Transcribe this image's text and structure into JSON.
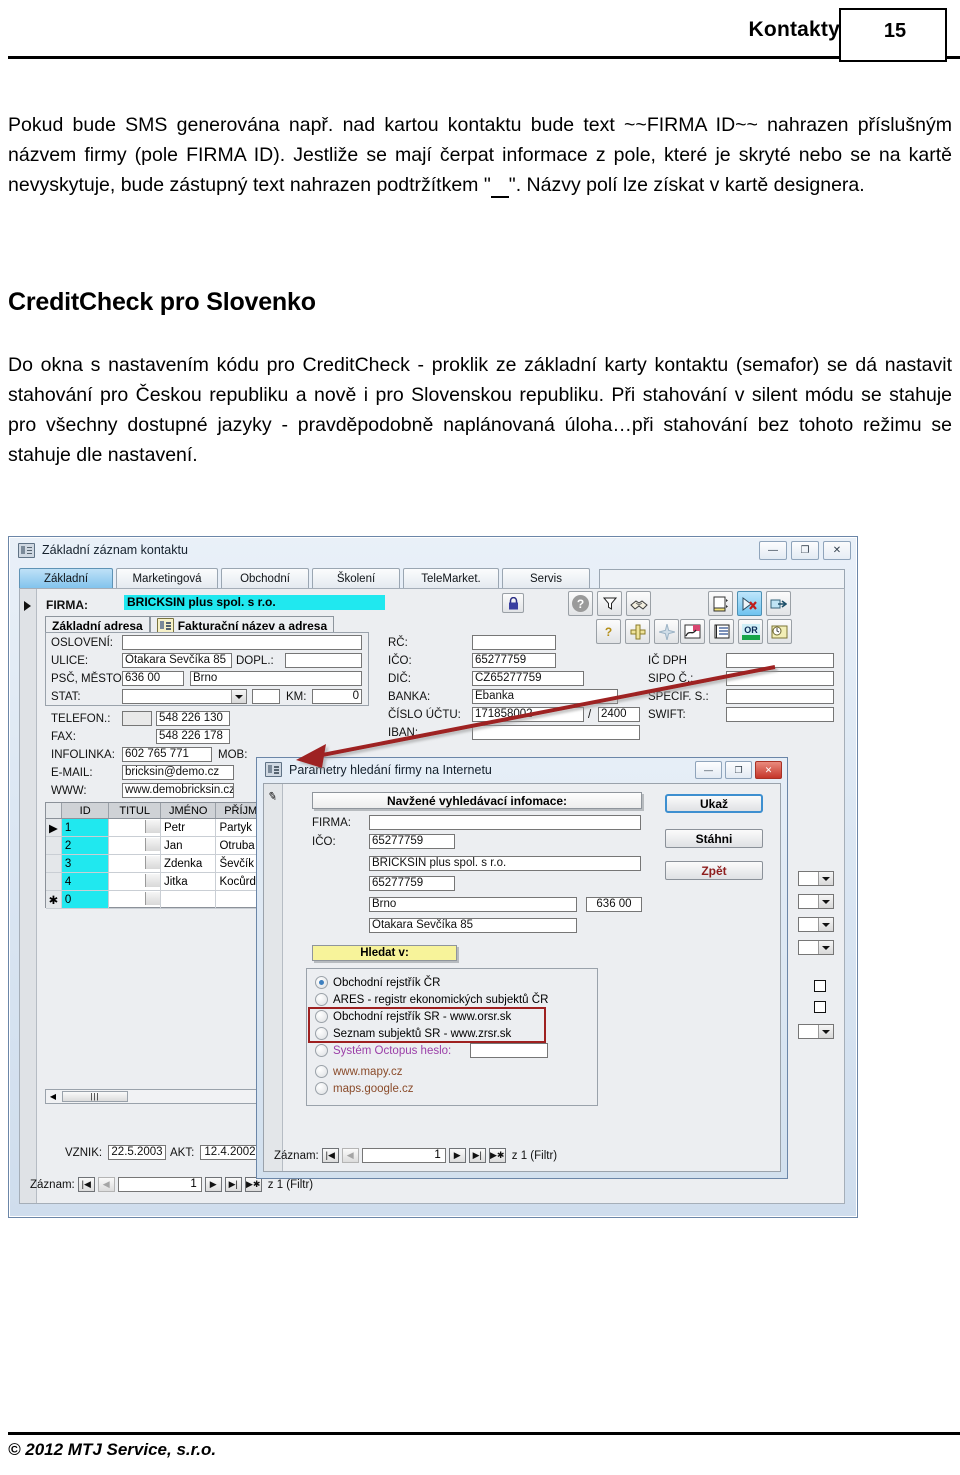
{
  "page": {
    "header_title": "Kontakty",
    "page_number": "15",
    "footer": "© 2012 MTJ Service, s.r.o."
  },
  "content": {
    "paragraph1": "Pokud bude SMS generována např. nad kartou kontaktu bude text ~~FIRMA ID~~ nahrazen příslušným názvem firmy (pole FIRMA ID). Jestliže se mají čerpat informace z pole, které je skryté nebo se na kartě nevyskytuje, bude zástupný text nahrazen podtržítkem \"",
    "paragraph1_end": "\". Názvy polí lze získat v kartě designera.",
    "section_title": "CreditCheck pro Slovenko",
    "paragraph2": "Do okna s nastavením kódu pro CreditCheck - proklik ze základní karty kontaktu (semafor) se dá nastavit stahování pro Českou republiku a nově i pro Slovenskou republiku. Při stahování v silent módu se stahuje pro všechny dostupné jazyky - pravděpodobně naplánovaná úloha…při stahování bez tohoto režimu se stahuje dle nastavení."
  },
  "main_window": {
    "title": "Základní záznam kontaktu",
    "window_buttons": {
      "minimize": "—",
      "maximize": "❐",
      "close": "✕"
    },
    "tabs": [
      {
        "label": "Základní",
        "selected": true
      },
      {
        "label": "Marketingová",
        "selected": false
      },
      {
        "label": "Obchodní",
        "selected": false
      },
      {
        "label": "Školení",
        "selected": false
      },
      {
        "label": "TeleMarket.",
        "selected": false
      },
      {
        "label": "Servis",
        "selected": false
      }
    ],
    "firma_label": "FIRMA:",
    "firma_value": "BRICKSIN plus spol.  s r.o.",
    "lock_icon": "lock-icon",
    "subtabs": [
      {
        "label": "Základní adresa",
        "selected": true
      },
      {
        "label": "Fakturační název a adresa",
        "selected": false
      }
    ],
    "address_fields": [
      {
        "label": "OSLOVENÍ:",
        "value": ""
      },
      {
        "label": "ULICE:",
        "value": "Otakara Ševčíka 85"
      },
      {
        "label": "DOPL.:",
        "value": ""
      },
      {
        "label": "PSČ, MĚSTO:",
        "value": "636 00"
      },
      {
        "label": "",
        "value": "Brno"
      },
      {
        "label": "STAT:",
        "value": ""
      },
      {
        "label": "KM:",
        "value": "0"
      }
    ],
    "contact_fields": [
      {
        "label": "TELEFON.:",
        "value": "548 226 130"
      },
      {
        "label": "FAX:",
        "value": "548 226 178"
      },
      {
        "label": "INFOLINKA:",
        "value": "602 765 771"
      },
      {
        "label": "MOB:",
        "value": ""
      },
      {
        "label": "E-MAIL:",
        "value": "bricksin@demo.cz"
      },
      {
        "label": "WWW:",
        "value": "www.demobricksin.cz"
      }
    ],
    "id_fields": [
      {
        "label": "RČ:",
        "value": ""
      },
      {
        "label": "IČO:",
        "value": "65277759"
      },
      {
        "label": "DIČ:",
        "value": "CZ65277759"
      },
      {
        "label": "BANKA:",
        "value": "Ebanka"
      },
      {
        "label": "ČÍSLO ÚČTU:",
        "value": "171858002"
      },
      {
        "label": "/",
        "value": "2400"
      },
      {
        "label": "IBAN:",
        "value": ""
      }
    ],
    "right_fields": [
      {
        "label": "IČ DPH",
        "value": ""
      },
      {
        "label": "SIPO Č.:",
        "value": ""
      },
      {
        "label": "SPECIF. S.:",
        "value": ""
      },
      {
        "label": "SWIFT:",
        "value": ""
      }
    ],
    "toolbar_icons": [
      "help-icon",
      "filter-icon",
      "handshake-icon",
      "book-icon",
      "no-entry-icon",
      "export-arrow-icon",
      "hint-icon",
      "ruler-icon",
      "sparkle-icon",
      "signature-icon",
      "list-icon",
      "or-icon",
      "stamp-icon"
    ],
    "grid": {
      "columns": [
        "ID",
        "TITUL",
        "JMÉNO",
        "PŘÍJM"
      ],
      "rows": [
        {
          "marker": "▶",
          "id": "1",
          "titul": "",
          "jmeno": "Petr",
          "prijm": "Partyk"
        },
        {
          "marker": "",
          "id": "2",
          "titul": "",
          "jmeno": "Jan",
          "prijm": "Otruba"
        },
        {
          "marker": "",
          "id": "3",
          "titul": "",
          "jmeno": "Zdenka",
          "prijm": "Ševčík"
        },
        {
          "marker": "",
          "id": "4",
          "titul": "",
          "jmeno": "Jitka",
          "prijm": "Kocůrd"
        },
        {
          "marker": "✱",
          "id": "0",
          "titul": "",
          "jmeno": "",
          "prijm": ""
        }
      ]
    },
    "dates": {
      "vznik_label": "VZNIK:",
      "vznik_value": "22.5.2003",
      "akt_label": "AKT:",
      "akt_value": "12.4.2002"
    },
    "navigator": {
      "label": "Záznam:",
      "first": "|◀",
      "prev": "◀",
      "current": "1",
      "next": "▶",
      "last": "▶|",
      "new": "▶✱",
      "of": "z  1 (Filtr)"
    }
  },
  "dialog": {
    "title": "Parametry hledání firmy na Internetu",
    "window_buttons": {
      "minimize": "—",
      "maximize": "❐",
      "close": "✕"
    },
    "banner": "Navžené vyhledávací infomace:",
    "fields": [
      {
        "label": "FIRMA:",
        "value": ""
      },
      {
        "label": "IČO:",
        "value": "65277759"
      }
    ],
    "suggestions": [
      {
        "value": "BRICKSIN plus spol.  s r.o."
      },
      {
        "value": "65277759"
      },
      {
        "value": "Brno",
        "extra": "636 00"
      },
      {
        "value": "Otakara Ševčíka 85"
      }
    ],
    "search_banner": "Hledat v:",
    "buttons": [
      {
        "label": "Ukaž",
        "focused": true
      },
      {
        "label": "Stáhni",
        "focused": false
      },
      {
        "label": "Zpět",
        "focused": false
      }
    ],
    "radio_options": [
      {
        "label": "Obchodní rejstřík ČR",
        "selected": true,
        "color": "black",
        "highlighted": false
      },
      {
        "label": "ARES - registr ekonomických subjektů ČR",
        "selected": false,
        "color": "black",
        "highlighted": false
      },
      {
        "label": "Obchodní rejstřík SR - www.orsr.sk",
        "selected": false,
        "color": "black",
        "highlighted": true
      },
      {
        "label": "Seznam subjektů SR - www.zrsr.sk",
        "selected": false,
        "color": "black",
        "highlighted": true
      },
      {
        "label": "Systém Octopus  heslo:",
        "selected": false,
        "color": "purple",
        "highlighted": false,
        "has_input": true,
        "input_value": ""
      },
      {
        "label": "www.mapy.cz",
        "selected": false,
        "color": "brown",
        "highlighted": false
      },
      {
        "label": "maps.google.cz",
        "selected": false,
        "color": "brown",
        "highlighted": false
      }
    ],
    "navigator": {
      "label": "Záznam:",
      "first": "|◀",
      "prev": "◀",
      "current": "1",
      "next": "▶",
      "last": "▶|",
      "new": "▶✱",
      "of": "z  1 (Filtr)"
    }
  },
  "colors": {
    "highlight_cyan": "#20e8ef",
    "annotation_red": "#9e2020",
    "title_blue": "#dce7f3",
    "yellow_banner": "#f7f39a"
  }
}
